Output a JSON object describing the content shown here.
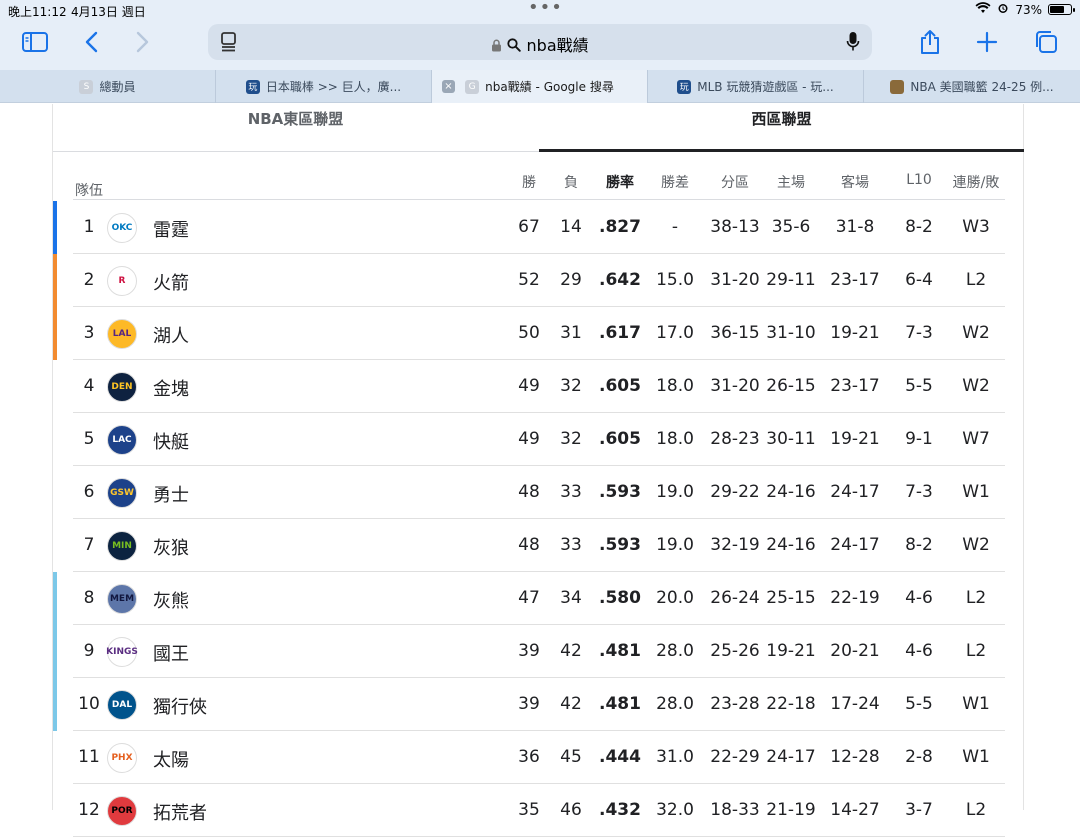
{
  "status": {
    "time": "晚上11:12",
    "date": "4月13日 週日",
    "battery_pct": "73%",
    "battery_level": 0.73
  },
  "toolbar": {
    "address": "nba戰績"
  },
  "tabs": [
    {
      "label": "總動員",
      "fav_text": "S",
      "fav_color": "#c9cfd8"
    },
    {
      "label": "日本職棒 >> 巨人，廣...",
      "fav_text": "玩",
      "fav_color": "#1f4e8c"
    },
    {
      "label": "nba戰績 - Google 搜尋",
      "fav_text": "G",
      "fav_color": "#c9cfd8",
      "active": true
    },
    {
      "label": "MLB 玩競猜遊戲區 - 玩...",
      "fav_text": "玩",
      "fav_color": "#1f4e8c"
    },
    {
      "label": "NBA 美國職籃 24-25 例...",
      "fav_text": "",
      "fav_color": "#8a6a3a"
    }
  ],
  "conference_tabs": {
    "east": "NBA東區聯盟",
    "west": "西區聯盟"
  },
  "table": {
    "headers": {
      "team": "隊伍",
      "w": "勝",
      "l": "負",
      "pct": "勝率",
      "gb": "勝差",
      "div": "分區",
      "home": "主場",
      "away": "客場",
      "l10": "L10",
      "strk": "連勝/敗"
    },
    "rows": [
      {
        "rank": "1",
        "team": "雷霆",
        "logo": "OKC",
        "logo_color": "#ffffff",
        "logo_fg": "#007ac1",
        "seed_color": "#1a73e8",
        "w": "67",
        "l": "14",
        "pct": ".827",
        "gb": "-",
        "div": "38-13",
        "home": "35-6",
        "away": "31-8",
        "l10": "8-2",
        "strk": "W3"
      },
      {
        "rank": "2",
        "team": "火箭",
        "logo": "R",
        "logo_color": "#ffffff",
        "logo_fg": "#ce1141",
        "seed_color": "#f28b30",
        "w": "52",
        "l": "29",
        "pct": ".642",
        "gb": "15.0",
        "div": "31-20",
        "home": "29-11",
        "away": "23-17",
        "l10": "6-4",
        "strk": "L2"
      },
      {
        "rank": "3",
        "team": "湖人",
        "logo": "LAL",
        "logo_color": "#fdb927",
        "logo_fg": "#552583",
        "seed_color": "#f28b30",
        "w": "50",
        "l": "31",
        "pct": ".617",
        "gb": "17.0",
        "div": "36-15",
        "home": "31-10",
        "away": "19-21",
        "l10": "7-3",
        "strk": "W2"
      },
      {
        "rank": "4",
        "team": "金塊",
        "logo": "DEN",
        "logo_color": "#0e2240",
        "logo_fg": "#fec524",
        "seed_color": "",
        "w": "49",
        "l": "32",
        "pct": ".605",
        "gb": "18.0",
        "div": "31-20",
        "home": "26-15",
        "away": "23-17",
        "l10": "5-5",
        "strk": "W2"
      },
      {
        "rank": "5",
        "team": "快艇",
        "logo": "LAC",
        "logo_color": "#1d428a",
        "logo_fg": "#ffffff",
        "seed_color": "",
        "w": "49",
        "l": "32",
        "pct": ".605",
        "gb": "18.0",
        "div": "28-23",
        "home": "30-11",
        "away": "19-21",
        "l10": "9-1",
        "strk": "W7"
      },
      {
        "rank": "6",
        "team": "勇士",
        "logo": "GSW",
        "logo_color": "#1d428a",
        "logo_fg": "#ffc72c",
        "seed_color": "",
        "w": "48",
        "l": "33",
        "pct": ".593",
        "gb": "19.0",
        "div": "29-22",
        "home": "24-16",
        "away": "24-17",
        "l10": "7-3",
        "strk": "W1"
      },
      {
        "rank": "7",
        "team": "灰狼",
        "logo": "MIN",
        "logo_color": "#0c2340",
        "logo_fg": "#78be20",
        "seed_color": "",
        "w": "48",
        "l": "33",
        "pct": ".593",
        "gb": "19.0",
        "div": "32-19",
        "home": "24-16",
        "away": "24-17",
        "l10": "8-2",
        "strk": "W2"
      },
      {
        "rank": "8",
        "team": "灰熊",
        "logo": "MEM",
        "logo_color": "#5d76a9",
        "logo_fg": "#12173f",
        "seed_color": "#7cc8e8",
        "w": "47",
        "l": "34",
        "pct": ".580",
        "gb": "20.0",
        "div": "26-24",
        "home": "25-15",
        "away": "22-19",
        "l10": "4-6",
        "strk": "L2"
      },
      {
        "rank": "9",
        "team": "國王",
        "logo": "KINGS",
        "logo_color": "#ffffff",
        "logo_fg": "#5a2d81",
        "seed_color": "#7cc8e8",
        "w": "39",
        "l": "42",
        "pct": ".481",
        "gb": "28.0",
        "div": "25-26",
        "home": "19-21",
        "away": "20-21",
        "l10": "4-6",
        "strk": "L2"
      },
      {
        "rank": "10",
        "team": "獨行俠",
        "logo": "DAL",
        "logo_color": "#00538c",
        "logo_fg": "#ffffff",
        "seed_color": "#7cc8e8",
        "w": "39",
        "l": "42",
        "pct": ".481",
        "gb": "28.0",
        "div": "23-28",
        "home": "22-18",
        "away": "17-24",
        "l10": "5-5",
        "strk": "W1"
      },
      {
        "rank": "11",
        "team": "太陽",
        "logo": "PHX",
        "logo_color": "#ffffff",
        "logo_fg": "#e56020",
        "seed_color": "",
        "w": "36",
        "l": "45",
        "pct": ".444",
        "gb": "31.0",
        "div": "22-29",
        "home": "24-17",
        "away": "12-28",
        "l10": "2-8",
        "strk": "W1"
      },
      {
        "rank": "12",
        "team": "拓荒者",
        "logo": "POR",
        "logo_color": "#e03a3e",
        "logo_fg": "#000000",
        "seed_color": "",
        "w": "35",
        "l": "46",
        "pct": ".432",
        "gb": "32.0",
        "div": "18-33",
        "home": "21-19",
        "away": "14-27",
        "l10": "3-7",
        "strk": "L2"
      }
    ]
  }
}
